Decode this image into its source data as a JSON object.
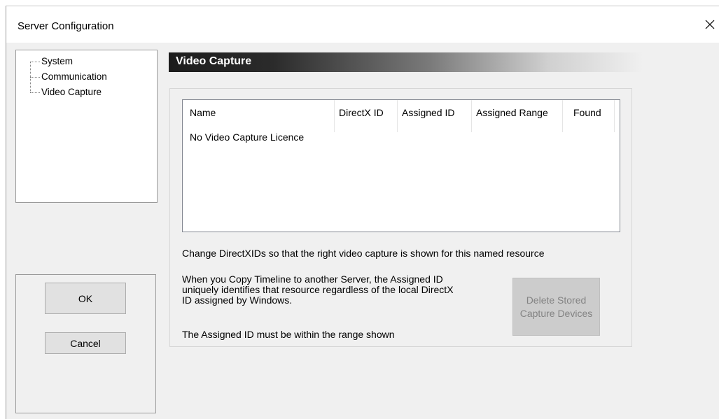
{
  "window": {
    "title": "Server Configuration",
    "close_icon": "close-icon"
  },
  "tree": {
    "items": [
      {
        "label": "System"
      },
      {
        "label": "Communication"
      },
      {
        "label": "Video Capture"
      }
    ]
  },
  "buttons": {
    "ok_label": "OK",
    "cancel_label": "Cancel"
  },
  "section": {
    "title": "Video Capture"
  },
  "table": {
    "columns": [
      "Name",
      "DirectX ID",
      "Assigned ID",
      "Assigned Range",
      "Found"
    ],
    "empty_message": "No Video Capture Licence"
  },
  "info": {
    "directx_note": "Change DirectXIDs so that the right video capture is shown for this named resource",
    "copy_note_line1": "When you Copy Timeline to another Server, the Assigned ID",
    "copy_note_line2": "uniquely identifies that resource regardless of the local DirectX",
    "copy_note_line3": "ID assigned by Windows.",
    "range_note": "The Assigned ID must be within the range shown"
  },
  "delete_button": {
    "line1": "Delete Stored",
    "line2": "Capture Devices",
    "enabled": false
  },
  "colors": {
    "window_bg": "#f0f0f0",
    "header_dark": "#1c1c1c",
    "disabled_button_bg": "#cccccc",
    "disabled_text": "#838383"
  }
}
